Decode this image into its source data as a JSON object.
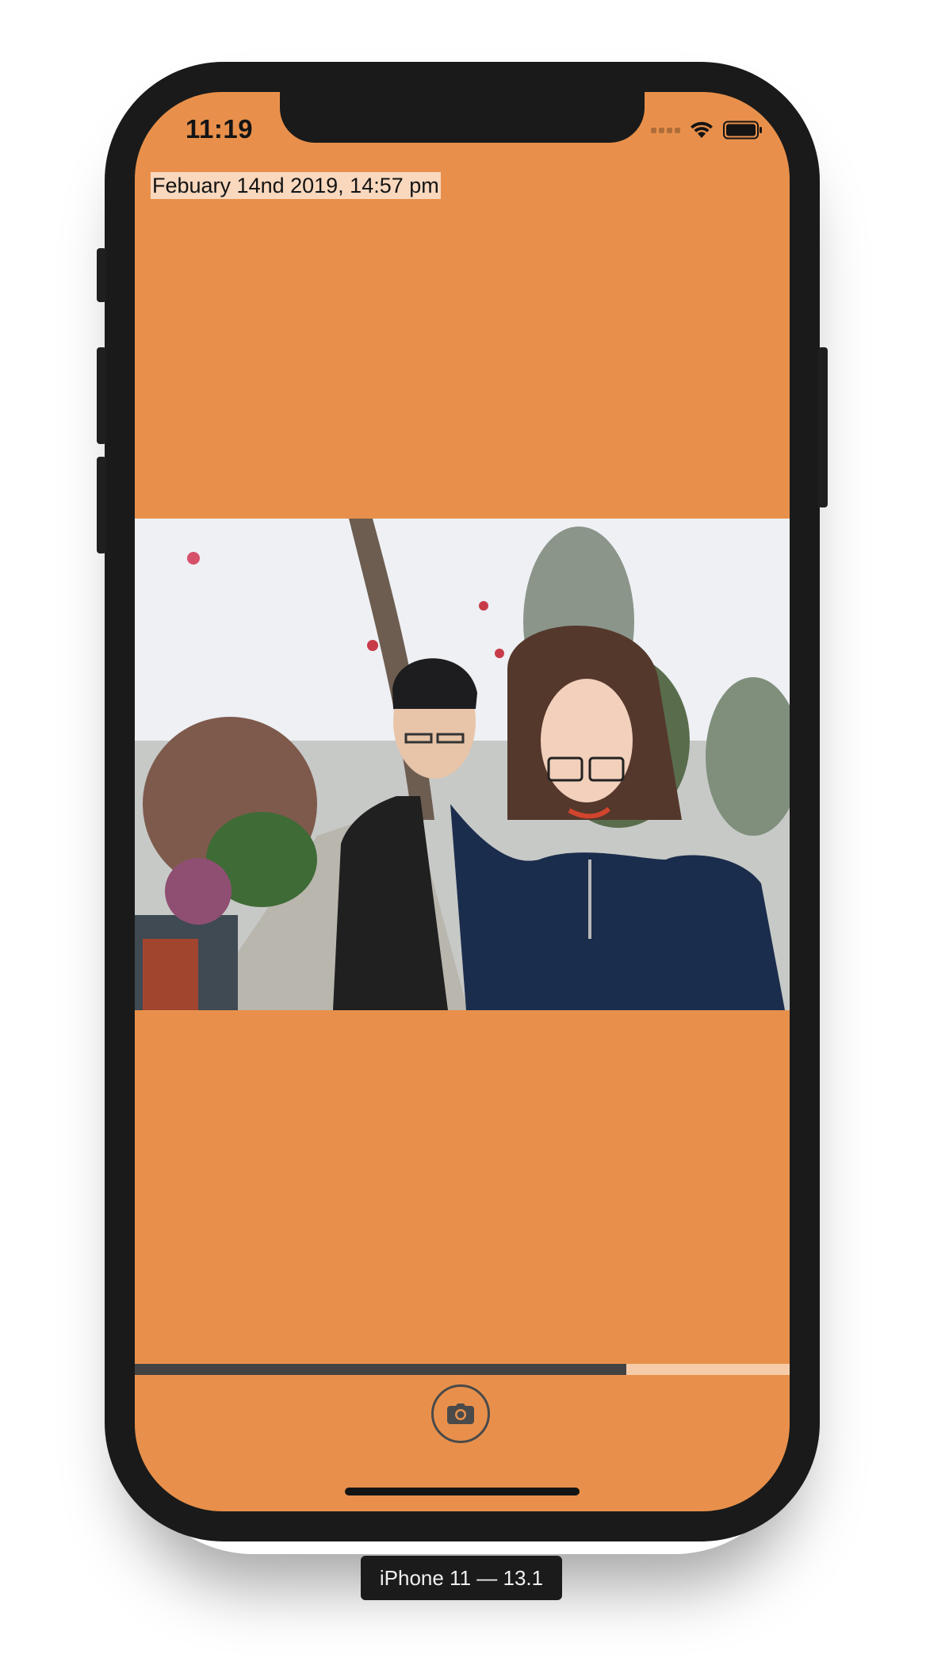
{
  "status_bar": {
    "time": "11:19",
    "icons": [
      "cellular-signal-icon",
      "wifi-icon",
      "battery-icon"
    ]
  },
  "header": {
    "date_label": "Febuary 14nd 2019, 14:57 pm"
  },
  "photo": {
    "description_icon": "photo-icon"
  },
  "progress": {
    "fraction": 0.75
  },
  "camera_button": {
    "icon": "camera-icon"
  },
  "simulator": {
    "device_label": "iPhone 11 — 13.1"
  },
  "colors": {
    "screen_background": "#e8904b",
    "progress_fill": "#434343",
    "progress_track": "#f6cca8",
    "date_label_background": "#fbe3d0"
  }
}
